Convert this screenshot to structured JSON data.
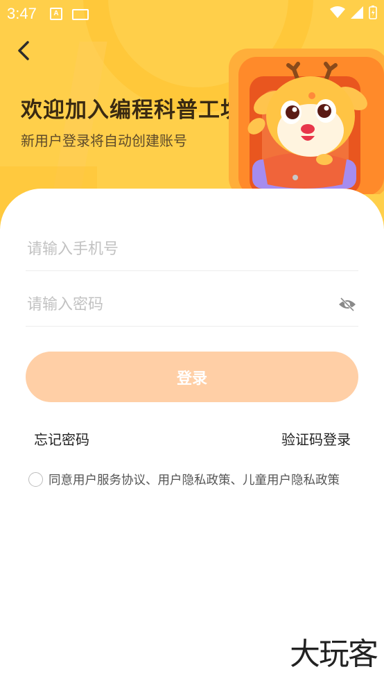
{
  "status_bar": {
    "time": "3:47"
  },
  "header": {
    "title": "欢迎加入编程科普工坊",
    "subtitle": "新用户登录将自动创建账号"
  },
  "form": {
    "phone_placeholder": "请输入手机号",
    "password_placeholder": "请输入密码",
    "login_label": "登录",
    "login_color": "#ffcfa6",
    "forgot_password": "忘记密码",
    "code_login": "验证码登录",
    "agreement": "同意用户服务协议、用户隐私政策、儿童用户隐私政策"
  },
  "watermark": "大玩客",
  "colors": {
    "hero_bg": "#ffcf4a",
    "title": "#3a2a12"
  }
}
